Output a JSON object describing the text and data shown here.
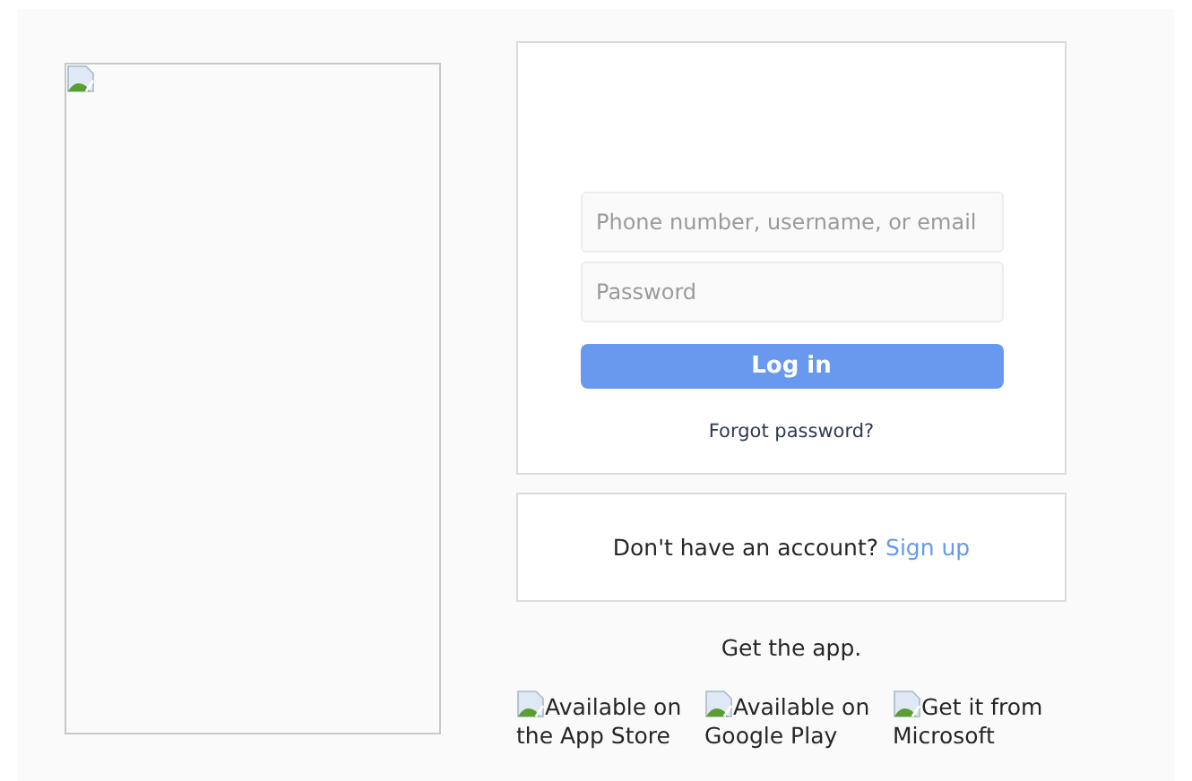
{
  "login": {
    "username": {
      "placeholder": "Phone number, username, or email"
    },
    "password": {
      "placeholder": "Password"
    },
    "submit": "Log in",
    "forgot": "Forgot password?"
  },
  "signup": {
    "prompt": "Don't have an account?",
    "link": "Sign up"
  },
  "get_app": "Get the app.",
  "badges": [
    {
      "alt": "Available on the App Store"
    },
    {
      "alt": "Available on Google Play"
    },
    {
      "alt": "Get it from Microsoft"
    }
  ]
}
